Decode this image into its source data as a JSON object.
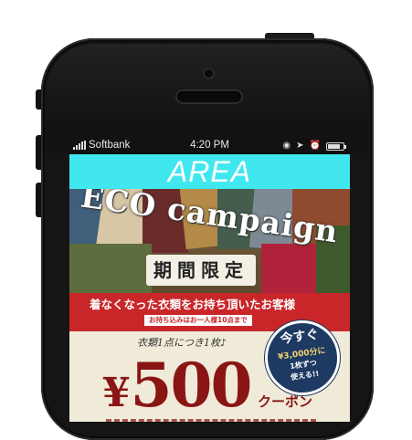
{
  "status_bar": {
    "carrier": "Softbank",
    "time": "4:20 PM"
  },
  "app": {
    "title": "AREA"
  },
  "banner": {
    "headline": "ECO campaign",
    "limited_label": "期間限定",
    "red_title": "着なくなった衣類をお持ち頂いたお客様",
    "red_subtitle": "お持ち込みはお一人様10点まで",
    "per_item": "衣類1点につき1枚♪",
    "price_yen": "¥",
    "price_amount": "500",
    "price_unit": "クーポン",
    "badge": {
      "heading": "今すぐ",
      "line1": "¥3,000分に",
      "line2": "1枚ずつ",
      "line3": "使える!!"
    }
  },
  "colors": {
    "accent_bar": "#41e7ef",
    "red_band": "#c9262a",
    "price": "#8a1515",
    "badge": "#1e3a63"
  },
  "icons": [
    "signal-bars-icon",
    "lock-rotation-icon",
    "location-arrow-icon",
    "alarm-icon",
    "battery-icon"
  ]
}
